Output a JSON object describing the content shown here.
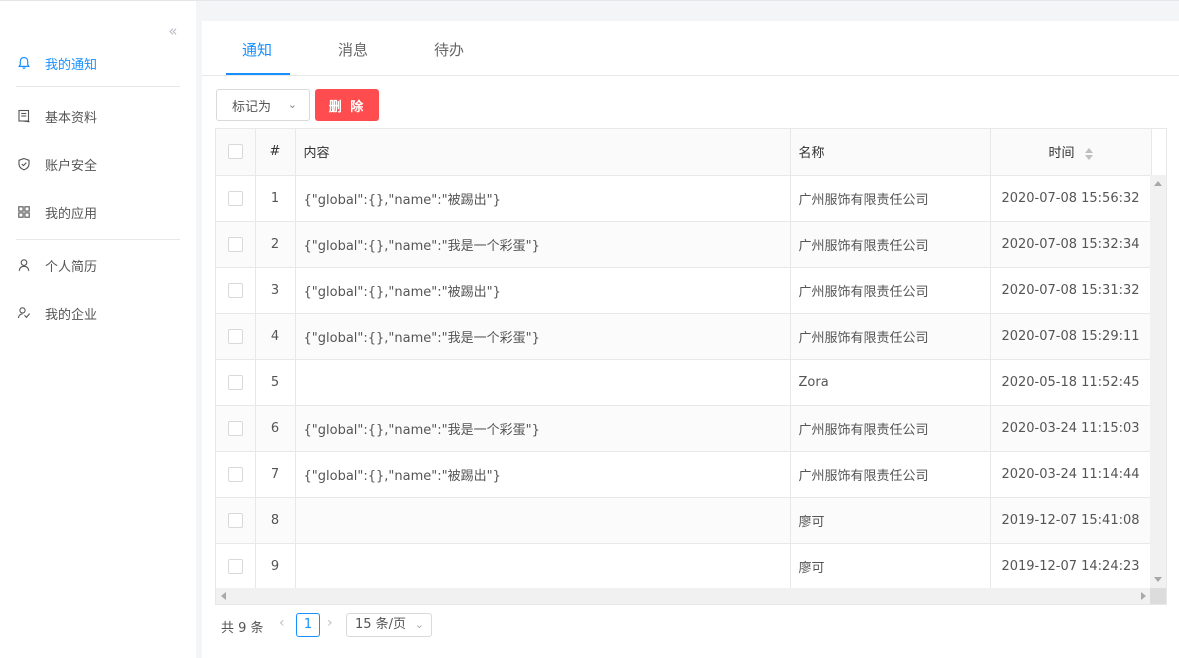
{
  "colors": {
    "accent": "#1890ff",
    "danger": "#ff4d4f"
  },
  "sidebar": {
    "collapse_glyph": "«",
    "items": [
      {
        "label": "我的通知",
        "icon": "bell-icon",
        "active": true
      },
      {
        "label": "基本资料",
        "icon": "profile-card-icon",
        "active": false
      },
      {
        "label": "账户安全",
        "icon": "shield-icon",
        "active": false
      },
      {
        "label": "我的应用",
        "icon": "grid-apps-icon",
        "active": false
      },
      {
        "label": "个人简历",
        "icon": "person-icon",
        "active": false
      },
      {
        "label": "我的企业",
        "icon": "enterprise-icon",
        "active": false
      }
    ]
  },
  "tabs": [
    {
      "label": "通知",
      "active": true
    },
    {
      "label": "消息",
      "active": false
    },
    {
      "label": "待办",
      "active": false
    }
  ],
  "toolbar": {
    "mark_label": "标记为",
    "delete_label": "删 除"
  },
  "table": {
    "columns": {
      "index": "#",
      "content": "内容",
      "name": "名称",
      "time": "时间"
    },
    "rows": [
      {
        "index": "1",
        "content": "{\"global\":{},\"name\":\"被踢出\"}",
        "name": "广州服饰有限责任公司",
        "time": "2020-07-08 15:56:32"
      },
      {
        "index": "2",
        "content": "{\"global\":{},\"name\":\"我是一个彩蛋\"}",
        "name": "广州服饰有限责任公司",
        "time": "2020-07-08 15:32:34"
      },
      {
        "index": "3",
        "content": "{\"global\":{},\"name\":\"被踢出\"}",
        "name": "广州服饰有限责任公司",
        "time": "2020-07-08 15:31:32"
      },
      {
        "index": "4",
        "content": "{\"global\":{},\"name\":\"我是一个彩蛋\"}",
        "name": "广州服饰有限责任公司",
        "time": "2020-07-08 15:29:11"
      },
      {
        "index": "5",
        "content": "",
        "name": "Zora",
        "time": "2020-05-18 11:52:45"
      },
      {
        "index": "6",
        "content": "{\"global\":{},\"name\":\"我是一个彩蛋\"}",
        "name": "广州服饰有限责任公司",
        "time": "2020-03-24 11:15:03"
      },
      {
        "index": "7",
        "content": "{\"global\":{},\"name\":\"被踢出\"}",
        "name": "广州服饰有限责任公司",
        "time": "2020-03-24 11:14:44"
      },
      {
        "index": "8",
        "content": "",
        "name": "廖可",
        "time": "2019-12-07 15:41:08"
      },
      {
        "index": "9",
        "content": "",
        "name": "廖可",
        "time": "2019-12-07 14:24:23"
      }
    ]
  },
  "pagination": {
    "total_text": "共 9 条",
    "current_page": "1",
    "page_size": "15 条/页"
  }
}
